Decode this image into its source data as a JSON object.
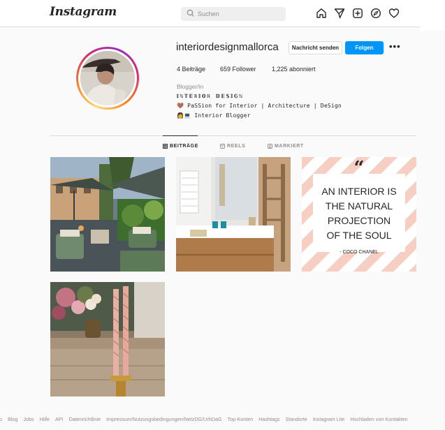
{
  "header": {
    "logo": "Instagram",
    "search_placeholder": "Suchen",
    "nav_icons": [
      "home-icon",
      "direct-icon",
      "new-post-icon",
      "explore-icon",
      "activity-icon"
    ]
  },
  "profile": {
    "username": "interiordesignmallorca",
    "message_button": "Nachricht senden",
    "follow_button": "Folgen",
    "more": "•••",
    "stats": {
      "posts": "4 Beiträge",
      "followers": "659 Follower",
      "following": "1,225 abonniert"
    },
    "bio": {
      "category": "Blogger/in",
      "title": "𝕀ℕ𝕋𝔼ℝ𝕀𝕆ℝ 𝔻𝔼𝕊𝕀𝔾ℕ",
      "line1": "🤎 PaSSion for Interior | Architecture | DeSign",
      "line2": "👩💻 Interior Blogger"
    }
  },
  "tabs": [
    {
      "label": "BEITRÄGE",
      "icon": "grid-icon",
      "active": true
    },
    {
      "label": "REELS",
      "icon": "reels-icon",
      "active": false
    },
    {
      "label": "MARKIERT",
      "icon": "tagged-icon",
      "active": false
    }
  ],
  "posts": {
    "quote_lines": [
      "AN INTERIOR IS",
      "THE NATURAL",
      "PROJECTION",
      "OF THE SOUL"
    ],
    "quote_author": "- COCO CHANEL",
    "quote_mark": "“"
  },
  "footer": [
    "fo",
    "Blog",
    "Jobs",
    "Hilfe",
    "API",
    "Datenrichtlinie",
    "Impressum/Nutzungsbedingungen/NetzDG/UrhDaG",
    "Top-Konten",
    "Hashtags",
    "Standorte",
    "Instagram Lite",
    "Hochladen von Kontakten"
  ],
  "colors": {
    "accent": "#0095f6",
    "text": "#262626",
    "muted": "#8e8e8e",
    "background": "#fafafa",
    "quote_stripe": "#f7cfc2"
  }
}
